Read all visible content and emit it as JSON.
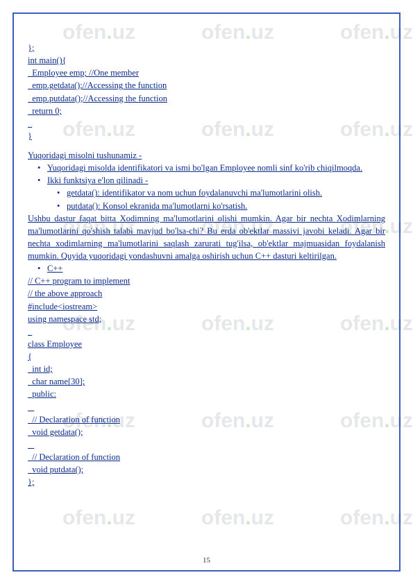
{
  "watermark": {
    "brand_left": "ofen",
    "brand_dot": ".",
    "brand_right": "uz"
  },
  "code_block_1": {
    "l1": "};",
    "l2": "int main(){",
    "l3": "  Employee emp; //One member",
    "l4": "  emp.getdata();//Accessing the function",
    "l5": "  emp.putdata();//Accessing the function",
    "l6": "  return 0;",
    "l7": "  ",
    "l8": "}"
  },
  "section_heading": "Yuqoridagi misolni tushunamiz -",
  "bullets_top": {
    "b1": "Yuqoridagi   misolda   identifikatori   va   ismi   bo'lgan   Employee   nomli   sinf   ko'rib chiqilmoqda.",
    "b2": "Ikki funktsiya e'lon qilinadi -",
    "b2a": "getdata(): identifikator va nom uchun foydalanuvchi ma'lumotlarini olish.",
    "b2b": "putdata(): Konsol ekranida ma'lumotlarni ko'rsatish."
  },
  "paragraph": "Ushbu  dastur   faqat  bitta   Xodimning  ma'lumotlarini  olishi  mumkin.  Agar  bir  nechta Xodimlarning   ma'lumotlarini   qo'shish   talabi   mavjud   bo'lsa-chi?   Bu   erda   ob'ektlar massivi  javobi  keladi.  Agar  bir  nechta  xodimlarning  ma'lumotlarini  saqlash  zarurati tug'ilsa,  ob'ektlar  majmuasidan  foydalanish  mumkin.  Quyida  yuqoridagi  yondashuvni amalga oshirish uchun C++ dasturi keltirilgan.",
  "cpp_label": "C++",
  "code_block_2": {
    "l1": "// C++ program to implement",
    "l2": "// the above approach",
    "l3": "#include<iostream>",
    "l4": "using namespace std;",
    "l5": "  ",
    "l6": "class Employee",
    "l7": "{",
    "l8": "  int id;",
    "l9": "  char name[30];",
    "l10": "  public:",
    "l11": "   ",
    "l12": "  // Declaration of function",
    "l13": "  void getdata();",
    "l14": "   ",
    "l15": "  // Declaration of function",
    "l16": "  void putdata();",
    "l17": "};"
  },
  "page_number": "15"
}
